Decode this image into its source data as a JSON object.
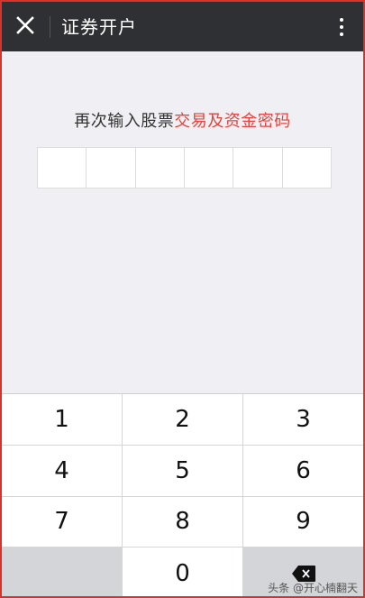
{
  "header": {
    "title": "证券开户",
    "close_icon": "close-icon",
    "more_icon": "more-vertical-icon"
  },
  "prompt": {
    "prefix": "再次输入股票",
    "highlight": "交易及资金密码"
  },
  "pin": {
    "length": 6
  },
  "keypad": {
    "rows": [
      [
        "1",
        "2",
        "3"
      ],
      [
        "4",
        "5",
        "6"
      ],
      [
        "7",
        "8",
        "9"
      ],
      [
        "",
        "0",
        "backspace"
      ]
    ],
    "backspace_icon": "backspace-icon"
  },
  "watermark": "头条 @开心楠翻天",
  "colors": {
    "topbar": "#2f3033",
    "highlight": "#e2453c",
    "frame_border": "#d9322b",
    "background": "#efeff4"
  }
}
